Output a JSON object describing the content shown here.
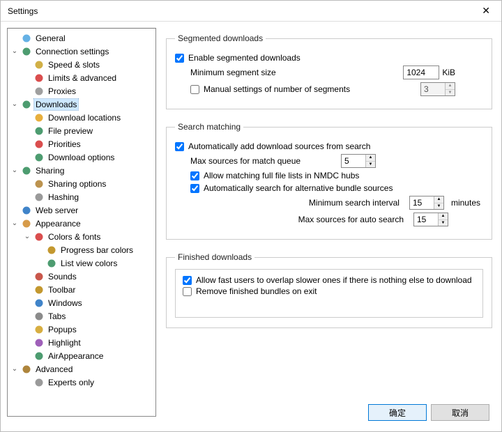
{
  "window": {
    "title": "Settings",
    "close_glyph": "✕"
  },
  "tree": [
    {
      "level": 1,
      "exp": "",
      "icon": "user-icon",
      "label": "General"
    },
    {
      "level": 1,
      "exp": "v",
      "icon": "globe-icon",
      "label": "Connection settings"
    },
    {
      "level": 2,
      "exp": "",
      "icon": "speed-icon",
      "label": "Speed & slots"
    },
    {
      "level": 2,
      "exp": "",
      "icon": "limits-icon",
      "label": "Limits & advanced"
    },
    {
      "level": 2,
      "exp": "",
      "icon": "proxies-icon",
      "label": "Proxies"
    },
    {
      "level": 1,
      "exp": "v",
      "icon": "downloads-icon",
      "label": "Downloads",
      "selected": true
    },
    {
      "level": 2,
      "exp": "",
      "icon": "folder-icon",
      "label": "Download locations"
    },
    {
      "level": 2,
      "exp": "",
      "icon": "preview-icon",
      "label": "File preview"
    },
    {
      "level": 2,
      "exp": "",
      "icon": "priority-icon",
      "label": "Priorities"
    },
    {
      "level": 2,
      "exp": "",
      "icon": "opts-icon",
      "label": "Download options"
    },
    {
      "level": 1,
      "exp": "v",
      "icon": "sharing-icon",
      "label": "Sharing"
    },
    {
      "level": 2,
      "exp": "",
      "icon": "shareopt-icon",
      "label": "Sharing options"
    },
    {
      "level": 2,
      "exp": "",
      "icon": "hash-icon",
      "label": "Hashing"
    },
    {
      "level": 1,
      "exp": "",
      "icon": "web-icon",
      "label": "Web server"
    },
    {
      "level": 1,
      "exp": "v",
      "icon": "palette-icon",
      "label": "Appearance"
    },
    {
      "level": 2,
      "exp": "v",
      "icon": "colors-icon",
      "label": "Colors & fonts"
    },
    {
      "level": 3,
      "exp": "",
      "icon": "progress-icon",
      "label": "Progress bar colors"
    },
    {
      "level": 3,
      "exp": "",
      "icon": "list-icon",
      "label": "List view colors"
    },
    {
      "level": 2,
      "exp": "",
      "icon": "sounds-icon",
      "label": "Sounds"
    },
    {
      "level": 2,
      "exp": "",
      "icon": "toolbar-icon",
      "label": "Toolbar"
    },
    {
      "level": 2,
      "exp": "",
      "icon": "windows-icon",
      "label": "Windows"
    },
    {
      "level": 2,
      "exp": "",
      "icon": "tabs-icon",
      "label": "Tabs"
    },
    {
      "level": 2,
      "exp": "",
      "icon": "popups-icon",
      "label": "Popups"
    },
    {
      "level": 2,
      "exp": "",
      "icon": "highlight-icon",
      "label": "Highlight"
    },
    {
      "level": 2,
      "exp": "",
      "icon": "air-icon",
      "label": "AirAppearance"
    },
    {
      "level": 1,
      "exp": "v",
      "icon": "advanced-icon",
      "label": "Advanced"
    },
    {
      "level": 2,
      "exp": "",
      "icon": "experts-icon",
      "label": "Experts only"
    }
  ],
  "icons": {
    "user-icon": "#4aa3e0",
    "globe-icon": "#2e8b57",
    "speed-icon": "#c9a227",
    "limits-icon": "#d32f2f",
    "proxies-icon": "#8e8e8e",
    "downloads-icon": "#2e8b57",
    "folder-icon": "#e4a11b",
    "preview-icon": "#2e8b57",
    "priority-icon": "#d32f2f",
    "opts-icon": "#2e8b57",
    "sharing-icon": "#2e8b57",
    "shareopt-icon": "#b08030",
    "hash-icon": "#888888",
    "web-icon": "#1e6fbf",
    "palette-icon": "#d08a2a",
    "colors-icon": "#d32f2f",
    "progress-icon": "#b8860b",
    "list-icon": "#2e8b57",
    "sounds-icon": "#c0392b",
    "toolbar-icon": "#b8860b",
    "windows-icon": "#1e6fbf",
    "tabs-icon": "#777777",
    "popups-icon": "#d0a020",
    "highlight-icon": "#8e44ad",
    "air-icon": "#2e8b57",
    "advanced-icon": "#a0701a",
    "experts-icon": "#888888"
  },
  "seg": {
    "legend": "Segmented downloads",
    "enable_label": "Enable segmented downloads",
    "enable_checked": true,
    "minsize_label": "Minimum segment size",
    "minsize_value": "1024",
    "minsize_unit": "KiB",
    "manual_label": "Manual settings of number of segments",
    "manual_checked": false,
    "manual_value": "3"
  },
  "search": {
    "legend": "Search matching",
    "auto_add_label": "Automatically add download sources from search",
    "auto_add_checked": true,
    "max_match_label": "Max sources for match queue",
    "max_match_value": "5",
    "allow_nmdc_label": "Allow matching full file lists in NMDC hubs",
    "allow_nmdc_checked": true,
    "auto_alt_label": "Automatically search for alternative bundle sources",
    "auto_alt_checked": true,
    "min_interval_label": "Minimum search interval",
    "min_interval_value": "15",
    "min_interval_unit": "minutes",
    "max_auto_label": "Max sources for auto search",
    "max_auto_value": "15"
  },
  "finished": {
    "legend": "Finished downloads",
    "overlap_label": "Allow fast users to overlap slower ones if there is nothing else to download",
    "overlap_checked": true,
    "remove_label": "Remove finished bundles on exit",
    "remove_checked": false
  },
  "buttons": {
    "ok": "确定",
    "cancel": "取消"
  }
}
